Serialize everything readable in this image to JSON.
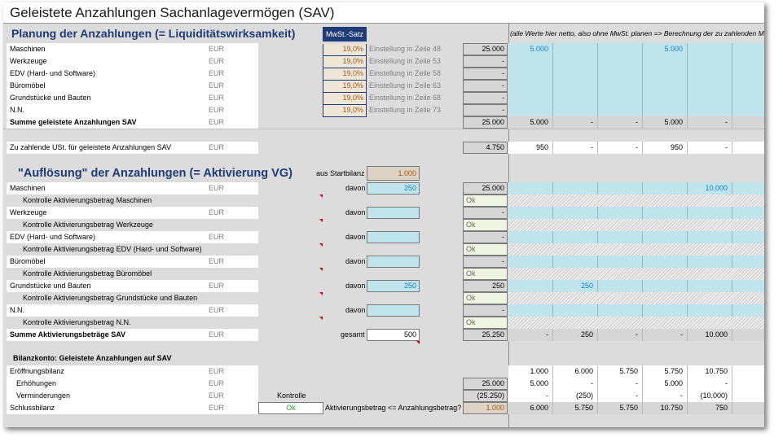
{
  "title": "Geleistete Anzahlungen Sachanlagevermögen (SAV)",
  "section1": {
    "heading": "Planung der Anzahlungen (= Liquiditätswirksamkeit)",
    "mwst_header": "MwSt.-Satz",
    "note": "(alle Werte hier netto, also ohne MwSt. planen => Berechnung der zu zahlenden M",
    "rows": [
      {
        "label": "Maschinen",
        "unit": "EUR",
        "rate": "19,0%",
        "setting": "Einstellung in Zeile 48",
        "total": "25.000",
        "periods": [
          "5.000",
          "",
          "",
          "5.000",
          "",
          ""
        ]
      },
      {
        "label": "Werkzeuge",
        "unit": "EUR",
        "rate": "19,0%",
        "setting": "Einstellung in Zeile 53",
        "total": "-",
        "periods": [
          "",
          "",
          "",
          "",
          "",
          ""
        ]
      },
      {
        "label": "EDV (Hard- und Software)",
        "unit": "EUR",
        "rate": "19,0%",
        "setting": "Einstellung in Zeile 58",
        "total": "-",
        "periods": [
          "",
          "",
          "",
          "",
          "",
          ""
        ]
      },
      {
        "label": "Büromöbel",
        "unit": "EUR",
        "rate": "19,0%",
        "setting": "Einstellung in Zeile 63",
        "total": "-",
        "periods": [
          "",
          "",
          "",
          "",
          "",
          ""
        ]
      },
      {
        "label": "Grundstücke und Bauten",
        "unit": "EUR",
        "rate": "19,0%",
        "setting": "Einstellung in Zeile 68",
        "total": "-",
        "periods": [
          "",
          "",
          "",
          "",
          "",
          ""
        ]
      },
      {
        "label": "N.N.",
        "unit": "EUR",
        "rate": "19,0%",
        "setting": "Einstellung in Zeile 73",
        "total": "-",
        "periods": [
          "",
          "",
          "",
          "",
          "",
          ""
        ]
      }
    ],
    "sum": {
      "label": "Summe geleistete Anzahlungen SAV",
      "unit": "EUR",
      "total": "25.000",
      "periods": [
        "5.000",
        "-",
        "-",
        "5.000",
        "-",
        "-"
      ]
    },
    "ust": {
      "label": "Zu zahlende USt. für geleistete Anzahlungen SAV",
      "unit": "EUR",
      "total": "4.750",
      "periods": [
        "950",
        "-",
        "-",
        "950",
        "-",
        "-"
      ]
    }
  },
  "section2": {
    "heading": "\"Auflösung\" der Anzahlungen (= Aktivierung VG)",
    "startbilanz_label": "aus Startbilanz",
    "startbilanz_value": "1.000",
    "davon_label": "davon",
    "rows": [
      {
        "label": "Maschinen",
        "unit": "EUR",
        "davon": "250",
        "total": "25.000",
        "periods": [
          "",
          "",
          "",
          "",
          "10.000",
          ""
        ],
        "check_label": "Kontrolle Aktivierungsbetrag Maschinen",
        "check": "Ok"
      },
      {
        "label": "Werkzeuge",
        "unit": "EUR",
        "davon": "",
        "total": "-",
        "periods": [
          "",
          "",
          "",
          "",
          "",
          ""
        ],
        "check_label": "Kontrolle Aktivierungsbetrag Werkzeuge",
        "check": "Ok"
      },
      {
        "label": "EDV (Hard- und Software)",
        "unit": "EUR",
        "davon": "",
        "total": "-",
        "periods": [
          "",
          "",
          "",
          "",
          "",
          ""
        ],
        "check_label": "Kontrolle Aktivierungsbetrag EDV (Hard- und Software)",
        "check": "Ok"
      },
      {
        "label": "Büromöbel",
        "unit": "EUR",
        "davon": "",
        "total": "-",
        "periods": [
          "",
          "",
          "",
          "",
          "",
          ""
        ],
        "check_label": "Kontrolle Aktivierungsbetrag Büromöbel",
        "check": "Ok"
      },
      {
        "label": "Grundstücke und Bauten",
        "unit": "EUR",
        "davon": "250",
        "total": "250",
        "periods": [
          "",
          "250",
          "",
          "",
          "",
          ""
        ],
        "check_label": "Kontrolle Aktivierungsbetrag Grundstücke und Bauten",
        "check": "Ok"
      },
      {
        "label": "N.N.",
        "unit": "EUR",
        "davon": "",
        "total": "-",
        "periods": [
          "",
          "",
          "",
          "",
          "",
          ""
        ],
        "check_label": "Kontrolle Aktivierungsbetrag N.N.",
        "check": "Ok"
      }
    ],
    "sum": {
      "label": "Summe Aktivierungsbeträge SAV",
      "unit": "EUR",
      "gesamt_label": "gesamt",
      "gesamt_value": "500",
      "total": "25.250",
      "periods": [
        "-",
        "250",
        "-",
        "-",
        "10.000",
        "-"
      ]
    }
  },
  "section3": {
    "heading": "Bilanzkonto: Geleistete Anzahlungen auf SAV",
    "rows": [
      {
        "label": "Eröffnungsbilanz",
        "unit": "EUR",
        "total": "",
        "periods": [
          "1.000",
          "6.000",
          "5.750",
          "5.750",
          "10.750",
          "7"
        ]
      },
      {
        "label": "Erhöhungen",
        "unit": "EUR",
        "total": "25.000",
        "periods": [
          "5.000",
          "-",
          "-",
          "5.000",
          "-",
          ""
        ]
      },
      {
        "label": "Verminderungen",
        "unit": "EUR",
        "total": "(25.250)",
        "periods": [
          "-",
          "(250)",
          "-",
          "-",
          "(10.000)",
          ""
        ]
      },
      {
        "label": "Schlussbilanz",
        "unit": "EUR",
        "total": "1.000",
        "periods": [
          "6.000",
          "5.750",
          "5.750",
          "10.750",
          "750",
          "7"
        ]
      }
    ],
    "kontrolle_label": "Kontrolle",
    "kontrolle_value": "Ok",
    "aktiv_check_label": "Aktivierungsbetrag <= Anzahlungsbetrag?"
  },
  "colors": {
    "accent": "#1f3b78",
    "input_blue": "#bfe4ec",
    "ok_green": "#2a9a2a",
    "value_blue": "#1a7fc4",
    "rate_brown": "#a05a1a"
  }
}
